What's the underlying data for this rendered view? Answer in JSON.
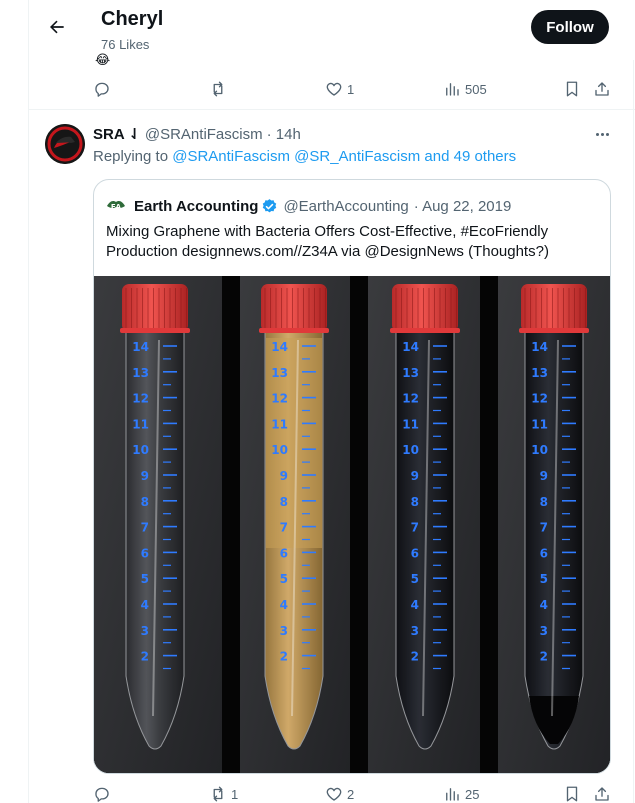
{
  "header": {
    "title": "Cheryl",
    "subtitle": "76 Likes",
    "emoji": "😂",
    "follow_label": "Follow"
  },
  "top_actions": {
    "replies": "",
    "reposts": "",
    "likes": "1",
    "views": "505"
  },
  "tweet": {
    "name": "SRA ⇃",
    "handle": "@SRAntiFascism",
    "time": "· 14h",
    "replying_prefix": "Replying to",
    "replying_link1": "@SRAntiFascism",
    "replying_link2": "@SR_AntiFascism",
    "replying_link3": "and 49 others",
    "quote": {
      "name": "Earth Accounting",
      "handle": "@EarthAccounting",
      "date": "· Aug 22, 2019",
      "text_line1": "Mixing Graphene with Bacteria Offers Cost-Effective, #EcoFriendly",
      "text_line2": "Production designnews.com//Z34A via @DesignNews (Thoughts?)"
    },
    "actions": {
      "replies": "",
      "reposts": "1",
      "likes": "2",
      "views": "25"
    }
  },
  "tube_scale": [
    "14",
    "13",
    "12",
    "11",
    "10",
    "9",
    "8",
    "7",
    "6",
    "5",
    "4",
    "3",
    "2"
  ],
  "colors": {
    "accent": "#1d9bf0",
    "text": "#0f1419",
    "muted": "#536471",
    "cap": "#e0393a",
    "scale": "#2f7bff"
  }
}
